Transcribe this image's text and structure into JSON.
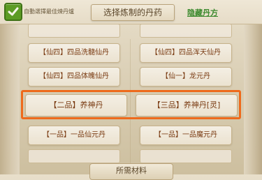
{
  "header": {
    "auto_select_label": "自動選擇最佳煉丹爐",
    "title": "选择炼制的丹药",
    "hide_link": "隐藏丹方"
  },
  "pills": [
    {
      "left": "【仙四】四品洗髓仙丹",
      "right": "【仙四】四品浑天仙丹"
    },
    {
      "left": "【仙四】四品体魄仙丹",
      "right": "【仙一】龙元丹"
    },
    {
      "left": "【二品】养神丹",
      "right": "【三品】养神丹[灵]"
    },
    {
      "left": "【一品】一品仙元丹",
      "right": "【一品】一品魔元丹"
    }
  ],
  "bottom": {
    "label": "所需材料"
  },
  "colors": {
    "highlight": "#ee6a1c",
    "link": "#3c8a2e",
    "pill_text": "#7a3b12"
  }
}
